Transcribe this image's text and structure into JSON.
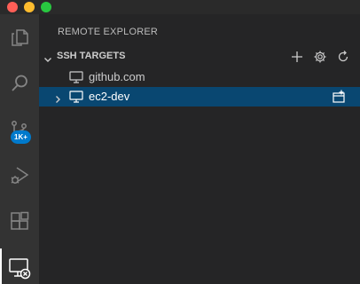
{
  "window": {
    "traffic_lights": [
      "close",
      "minimize",
      "zoom"
    ]
  },
  "activity_bar": {
    "items": [
      {
        "icon": "files-icon"
      },
      {
        "icon": "search-icon"
      },
      {
        "icon": "source-control-icon",
        "badge": "1K+"
      },
      {
        "icon": "run-debug-icon"
      },
      {
        "icon": "extensions-icon"
      },
      {
        "icon": "remote-explorer-icon",
        "active": true
      }
    ]
  },
  "sidebar": {
    "title": "REMOTE EXPLORER",
    "section": {
      "title": "SSH TARGETS",
      "actions": [
        "add-icon",
        "gear-icon",
        "refresh-icon"
      ]
    },
    "targets": [
      {
        "label": "github.com",
        "expandable": false
      },
      {
        "label": "ec2-dev",
        "expandable": true,
        "selected": true
      }
    ]
  },
  "colors": {
    "accent": "#007acc",
    "selection": "#094771",
    "activity_bar": "#333333",
    "sidebar": "#252526"
  }
}
